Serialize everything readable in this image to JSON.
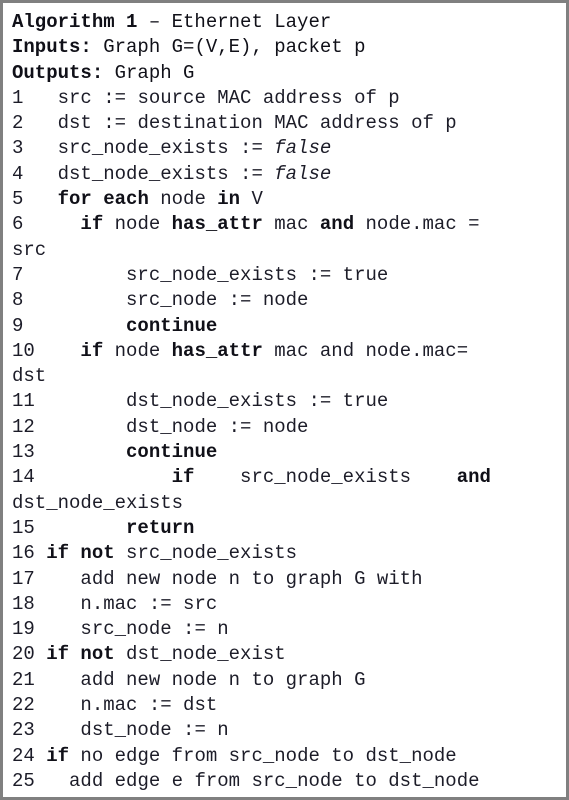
{
  "figure": {
    "kind": "algorithm-pseudocode-figure",
    "border_color": "#808080",
    "background_color": "#ffffff",
    "text_color": "#1c1c28"
  },
  "header": {
    "title_keyword": "Algorithm 1",
    "title_rest": " – Ethernet Layer",
    "inputs_keyword": "Inputs:",
    "inputs_rest": " Graph G=(V,E), packet p",
    "outputs_keyword": "Outputs:",
    "outputs_rest": " Graph G"
  },
  "lines": [
    {
      "num": "1",
      "indent": "  ",
      "pre": "src := source MAC address of p"
    },
    {
      "num": "2",
      "indent": "  ",
      "pre": "dst := destination MAC address of p"
    },
    {
      "num": "3",
      "indent": "  ",
      "pre": "src_node_exists := ",
      "italic": "false"
    },
    {
      "num": "4",
      "indent": "  ",
      "pre": "dst_node_exists := ",
      "italic": "false"
    },
    {
      "num": "5",
      "indent": "  ",
      "kw1": "for each",
      "mid": " node ",
      "kw2": "in",
      "post": " V"
    },
    {
      "num": "6",
      "indent": "    ",
      "kw1": "if",
      "mid": " node ",
      "kw2": "has_attr",
      "mid2": " mac ",
      "kw3": "and",
      "post": " node.mac =",
      "wrap": "src"
    },
    {
      "num": "7",
      "indent": "        ",
      "pre": "src_node_exists := true"
    },
    {
      "num": "8",
      "indent": "        ",
      "pre": "src_node := node"
    },
    {
      "num": "9",
      "indent": "        ",
      "kw1": "continue"
    },
    {
      "num": "10",
      "indent": "    ",
      "kw1": "if",
      "mid": " node ",
      "kw2": "has_attr",
      "post": " mac and node.mac=",
      "wrap": "dst"
    },
    {
      "num": "11",
      "indent": "        ",
      "pre": "dst_node_exists := true"
    },
    {
      "num": "12",
      "indent": "        ",
      "pre": "dst_node := node"
    },
    {
      "num": "13",
      "indent": "        ",
      "kw1": "continue"
    },
    {
      "num": "14",
      "indent": "            ",
      "kw1": "if",
      "mid": "    src_node_exists    ",
      "kw2": "and",
      "wrap": "dst_node_exists"
    },
    {
      "num": "15",
      "indent": "        ",
      "kw1": "return"
    },
    {
      "num": "16",
      "indent": " ",
      "kw1": "if not",
      "post": " src_node_exists"
    },
    {
      "num": "17",
      "indent": "    ",
      "pre": "add new node n to graph G with"
    },
    {
      "num": "18",
      "indent": "    ",
      "pre": "n.mac := src"
    },
    {
      "num": "19",
      "indent": "    ",
      "pre": "src_node := n"
    },
    {
      "num": "20",
      "indent": " ",
      "kw1": "if not",
      "post": " dst_node_exist"
    },
    {
      "num": "21",
      "indent": "    ",
      "pre": "add new node n to graph G"
    },
    {
      "num": "22",
      "indent": "    ",
      "pre": "n.mac := dst"
    },
    {
      "num": "23",
      "indent": "    ",
      "pre": "dst_node := n"
    },
    {
      "num": "24",
      "indent": " ",
      "kw1": "if",
      "post": " no edge from src_node to dst_node"
    },
    {
      "num": "25",
      "indent": "   ",
      "pre": "add edge e from src_node to dst_node"
    }
  ]
}
